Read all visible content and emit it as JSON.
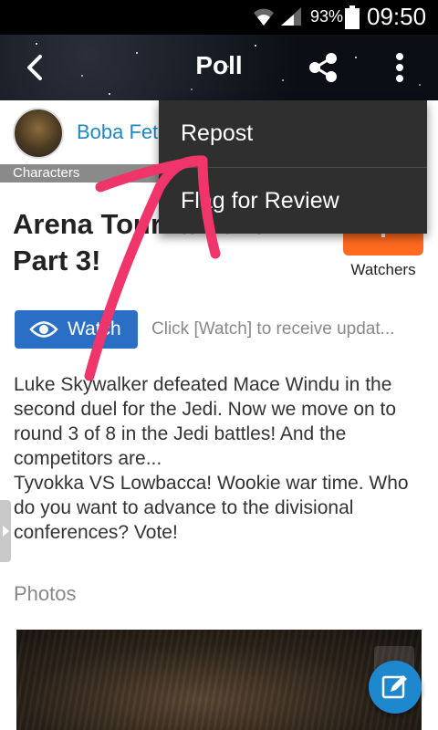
{
  "status_bar": {
    "battery_percent": "93%",
    "time": "09:50"
  },
  "app_bar": {
    "title": "Poll",
    "back_icon": "back-arrow-icon",
    "share_icon": "share-icon",
    "more_icon": "more-vert-icon"
  },
  "author": {
    "name": "Boba Fet"
  },
  "category": {
    "label": "Characters"
  },
  "post": {
    "title": "Arena Tournament Part 3!",
    "body": "Luke Skywalker defeated Mace Windu in the second duel for the Jedi. Now we move on to round 3 of 8 in the Jedi battles! And the competitors are...\nTyvokka VS Lowbacca! Wookie war time. Who do you want to advance to the divisional conferences? Vote!"
  },
  "watchers": {
    "label": "Watchers"
  },
  "watch": {
    "button_label": "Watch",
    "hint": "Click [Watch] to receive updat..."
  },
  "photos": {
    "label": "Photos"
  },
  "menu": {
    "items": [
      "Repost",
      "Flag for Review"
    ]
  },
  "colors": {
    "accent_blue": "#2a6fc5",
    "link_blue": "#1f87c6",
    "watchers_orange": "#ff6a1f",
    "annotation_pink": "#f0356a",
    "fab_blue": "#1e88cf"
  }
}
